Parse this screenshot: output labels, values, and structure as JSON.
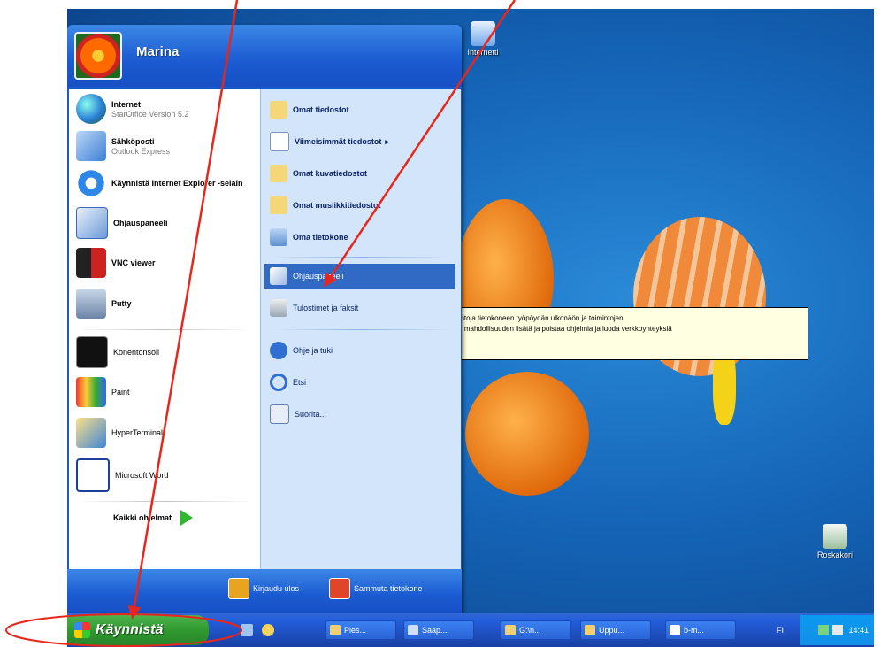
{
  "user": {
    "name": "Marina"
  },
  "start_menu": {
    "left_items": [
      {
        "title": "Internet",
        "subtitle": "StarOffice Version 5.2",
        "icon": "globe-icon",
        "bold": true
      },
      {
        "title": "Sähköposti",
        "subtitle": "Outlook Express",
        "icon": "email-icon",
        "bold": true
      },
      {
        "title": "Käynnistä Internet Explorer -selain",
        "subtitle": "",
        "icon": "internet-explorer-icon",
        "bold": true
      },
      {
        "title": "Ohjauspaneeli",
        "subtitle": "",
        "icon": "control-panel-icon",
        "bold": true
      },
      {
        "title": "VNC viewer",
        "subtitle": "",
        "icon": "vnc-icon",
        "bold": true
      },
      {
        "title": "Putty",
        "subtitle": "",
        "icon": "putty-icon",
        "bold": true
      },
      {
        "title": "Konentonsoli",
        "subtitle": "",
        "icon": "console-icon",
        "bold": false
      },
      {
        "title": "Paint",
        "subtitle": "",
        "icon": "paint-icon",
        "bold": false
      },
      {
        "title": "HyperTerminal",
        "subtitle": "",
        "icon": "hyperterminal-icon",
        "bold": false
      },
      {
        "title": "Microsoft Word",
        "subtitle": "",
        "icon": "word-icon",
        "bold": false
      }
    ],
    "all_programs": "Kaikki ohjelmat",
    "right_items": [
      {
        "label": "Omat tiedostot",
        "icon": "folder-icon",
        "bold": true
      },
      {
        "label": "Viimeisimmät tiedostot",
        "icon": "recent-docs-icon",
        "bold": true,
        "arrow": "▸"
      },
      {
        "label": "Omat kuvatiedostot",
        "icon": "pictures-folder-icon",
        "bold": true
      },
      {
        "label": "Omat musiikkitiedostot",
        "icon": "music-folder-icon",
        "bold": true
      },
      {
        "label": "Oma tietokone",
        "icon": "my-computer-icon",
        "bold": true
      },
      {
        "label": "Ohjauspaneeli",
        "icon": "control-panel-icon",
        "bold": false,
        "selected": true
      },
      {
        "label": "Tulostimet ja faksit",
        "icon": "printer-icon",
        "bold": false
      },
      {
        "label": "Ohje ja tuki",
        "icon": "help-icon",
        "bold": false
      },
      {
        "label": "Etsi",
        "icon": "search-icon",
        "bold": false
      },
      {
        "label": "Suorita...",
        "icon": "run-icon",
        "bold": false
      }
    ],
    "logoff": "Kirjaudu ulos",
    "shutdown": "Sammuta tietokone"
  },
  "tooltip": {
    "line1": "ehtoja tietokoneen työpöydän ulkonäön ja toimintojen",
    "line2": "n, mahdollisuuden lisätä ja poistaa ohjelmia ja luoda verkkoyhteyksiä"
  },
  "desktop": {
    "icon_top_label": "Internetti",
    "recycle_bin_label": "Roskakori"
  },
  "taskbar": {
    "start_label": "Käynnistä",
    "tasks": [
      "Ples...",
      "Saap...",
      "G:\\n...",
      "Uppu...",
      "b-m..."
    ],
    "language": "FI",
    "clock": "14:41"
  },
  "colors": {
    "taskbar_blue": "#245edb",
    "start_green": "#2f9a2f",
    "selection_blue": "#316ac5",
    "annotation_red": "#e8261b"
  }
}
